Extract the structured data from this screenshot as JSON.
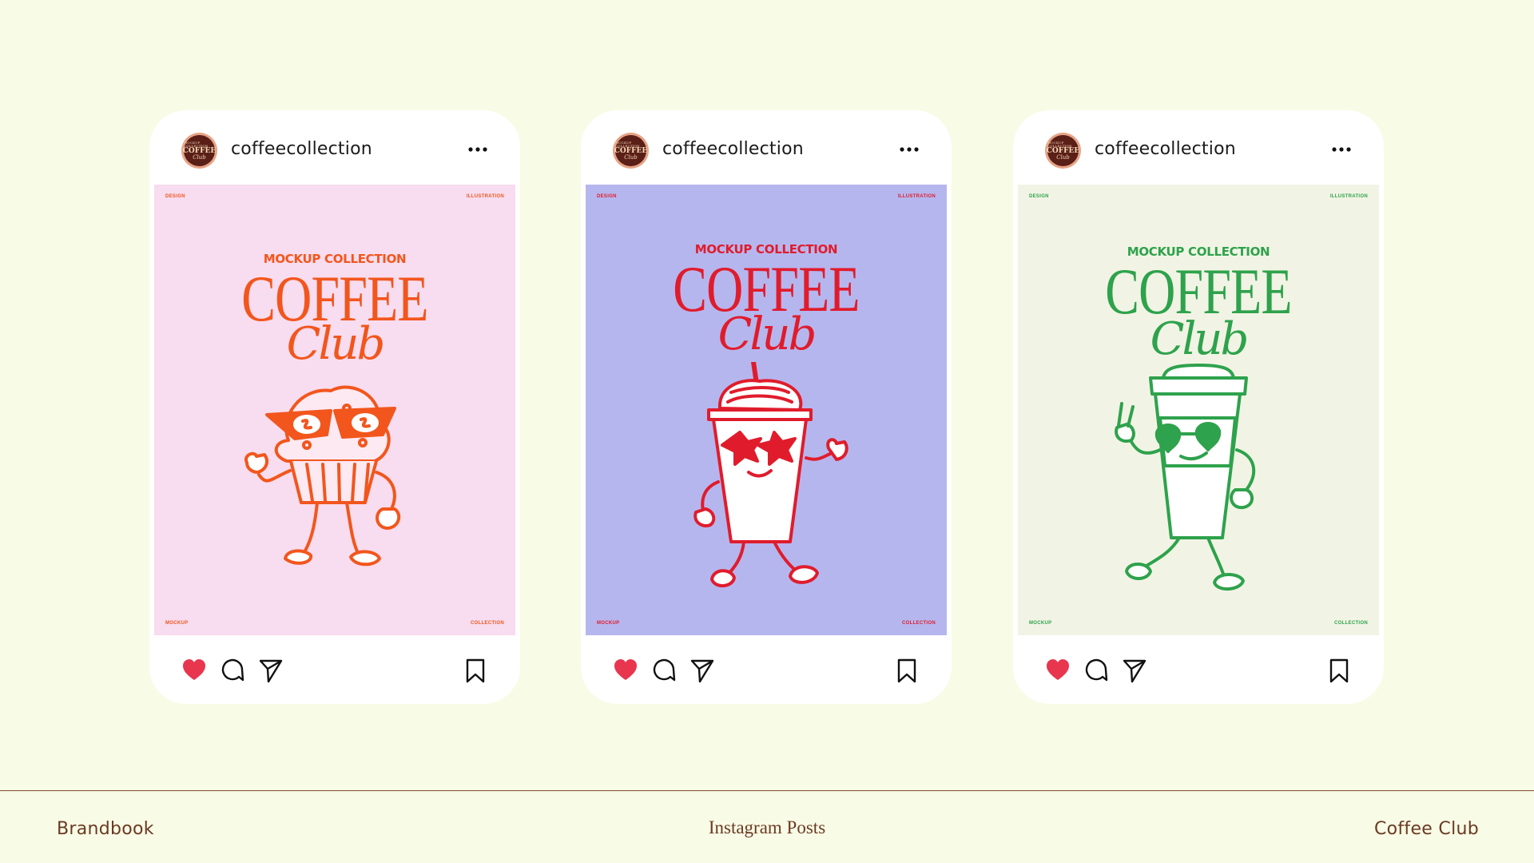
{
  "posts": [
    {
      "username": "coffeecollection",
      "avatar": {
        "top": "MOCKUP COLLECTION",
        "mid": "COFFEE",
        "bot": "Club"
      },
      "poster": {
        "bg": "#f8dcef",
        "ink": "#f2561d",
        "corner_tl": "DESIGN",
        "corner_tr": "ILLUSTRATION",
        "corner_bl": "MOCKUP",
        "corner_br": "COLLECTION",
        "subtitle": "MOCKUP COLLECTION",
        "title": "COFFEE",
        "script": "Club",
        "mascot": "muffin-mascot"
      },
      "liked": true
    },
    {
      "username": "coffeecollection",
      "avatar": {
        "top": "MOCKUP COLLECTION",
        "mid": "COFFEE",
        "bot": "Club"
      },
      "poster": {
        "bg": "#b6b6ee",
        "ink": "#e01c2c",
        "corner_tl": "DESIGN",
        "corner_tr": "ILLUSTRATION",
        "corner_bl": "MOCKUP",
        "corner_br": "COLLECTION",
        "subtitle": "MOCKUP COLLECTION",
        "title": "COFFEE",
        "script": "Club",
        "mascot": "frappe-cup-mascot"
      },
      "liked": true
    },
    {
      "username": "coffeecollection",
      "avatar": {
        "top": "MOCKUP COLLECTION",
        "mid": "COFFEE",
        "bot": "Club"
      },
      "poster": {
        "bg": "#f1f4e4",
        "ink": "#2ea24c",
        "corner_tl": "DESIGN",
        "corner_tr": "ILLUSTRATION",
        "corner_bl": "MOCKUP",
        "corner_br": "COLLECTION",
        "subtitle": "MOCKUP COLLECTION",
        "title": "COFFEE",
        "script": "Club",
        "mascot": "coffee-cup-mascot"
      },
      "liked": true
    }
  ],
  "icons": {
    "like": "heart-icon",
    "comment": "comment-icon",
    "share": "send-icon",
    "save": "bookmark-icon",
    "more": "more-icon"
  },
  "colors": {
    "background": "#f8fbe6",
    "like": "#e8364f",
    "footer_text": "#6b3a22"
  },
  "footer": {
    "left": "Brandbook",
    "center": "Instagram Posts",
    "right": "Coffee Club"
  }
}
